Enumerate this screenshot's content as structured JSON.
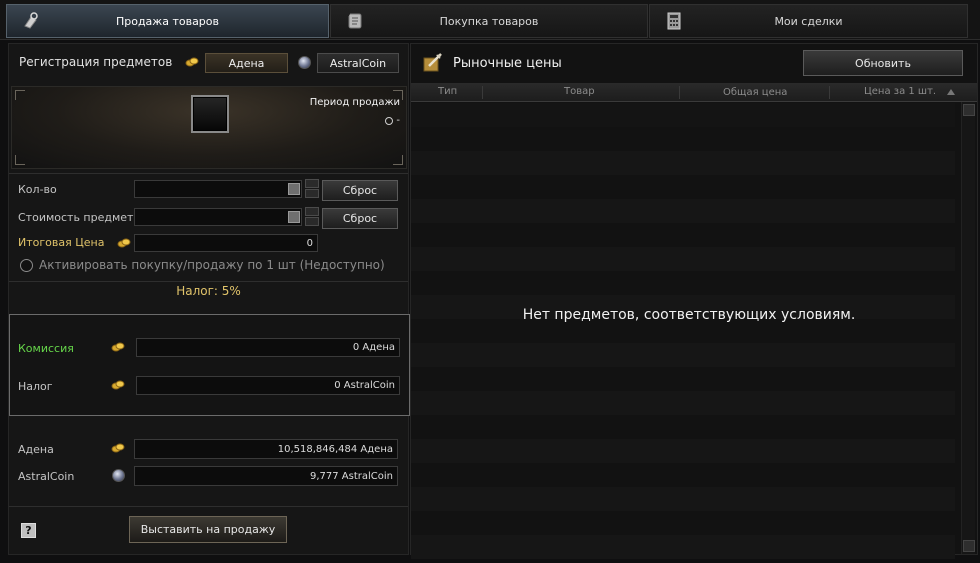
{
  "tabs": [
    {
      "label": "Продажа товаров",
      "icon": "sell-bag-icon",
      "active": true
    },
    {
      "label": "Покупка товаров",
      "icon": "scroll-icon",
      "active": false
    },
    {
      "label": "Мои сделки",
      "icon": "calculator-icon",
      "active": false
    }
  ],
  "registration": {
    "title": "Регистрация предметов",
    "currency_adena": "Адена",
    "currency_astral": "AstralCoin",
    "period_label": "Период продажи",
    "period_value": "-"
  },
  "form": {
    "qty_label": "Кол-во",
    "qty_value": "",
    "price_label": "Стоимость предмета",
    "price_value": "",
    "reset_label": "Сброс",
    "total_label": "Итоговая Цена",
    "total_value": "0",
    "single_unit_label": "Активировать покупку/продажу по 1 шт (Недоступно)",
    "tax_text": "Налог: 5%"
  },
  "fees": {
    "commission_label": "Комиссия",
    "commission_value": "0 Адена",
    "tax_label": "Налог",
    "tax_value": "0 AstralCoin"
  },
  "balances": {
    "adena_label": "Адена",
    "adena_value": "10,518,846,484 Адена",
    "astral_label": "AstralCoin",
    "astral_value": "9,777 AstralCoin"
  },
  "footer": {
    "help_label": "?",
    "sell_button": "Выставить на продажу"
  },
  "market": {
    "title": "Рыночные цены",
    "refresh_label": "Обновить",
    "columns": [
      "Тип",
      "Товар",
      "Общая цена",
      "Цена за 1 шт."
    ],
    "empty_message": "Нет предметов, соответствующих условиям."
  },
  "colors": {
    "accent_gold": "#e0c36a",
    "accent_green": "#66d64a",
    "active_tab": "#3b4651"
  }
}
